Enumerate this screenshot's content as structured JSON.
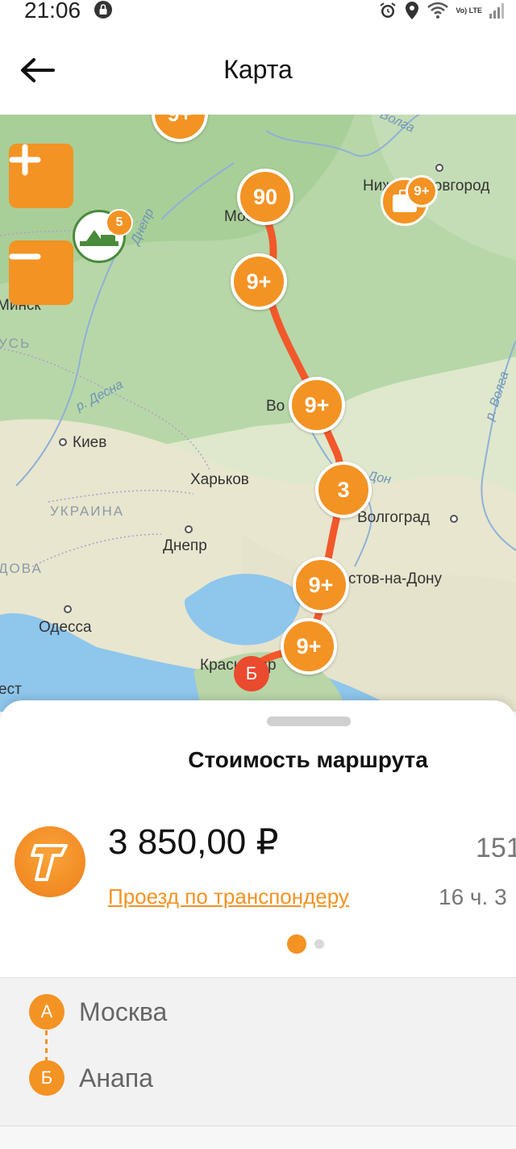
{
  "status_bar": {
    "time": "21:06",
    "network": "Vo) LTE"
  },
  "header": {
    "title": "Карта"
  },
  "map": {
    "labels": {
      "moscow": "Москва",
      "nizhny": "Нижний Новгород",
      "minsk": "Минск",
      "belarus": "УСЬ",
      "kiev": "Киев",
      "kharkov": "Харьков",
      "ukraine": "УКРАИНА",
      "dnepr": "Днепр",
      "moldova": "ДОВА",
      "odessa": "Одесса",
      "voronezh": "Во",
      "volgograd": "Волгоград",
      "rostov": "стов-на-Дону",
      "krasnodar": "Краснодар",
      "bucharest": "ест",
      "river_desna": "р. Десна",
      "river_dnepr": "Днепр",
      "river_don": "Дон",
      "river_volga": "р. Волга",
      "river_volga2": "Волга"
    },
    "clusters": {
      "top": "9+",
      "moscow": "90",
      "nizhny_badge": "9+",
      "near_minsk_badge": "5",
      "c1": "9+",
      "c2": "9+",
      "c3": "3",
      "c4": "9+",
      "c5": "9+"
    },
    "marker_end": "Б",
    "route_color": "#f2582a",
    "accent": "#f39323"
  },
  "sheet": {
    "title": "Стоимость маршрута",
    "price": "3 850,00 ₽",
    "payment_method": "Проезд по транспондеру",
    "distance_partial": "151",
    "time_partial": "16 ч. 3",
    "pager": {
      "pages": 2,
      "active": 1
    }
  },
  "route": {
    "from": {
      "badge": "А",
      "name": "Москва"
    },
    "to": {
      "badge": "Б",
      "name": "Анапа"
    }
  }
}
